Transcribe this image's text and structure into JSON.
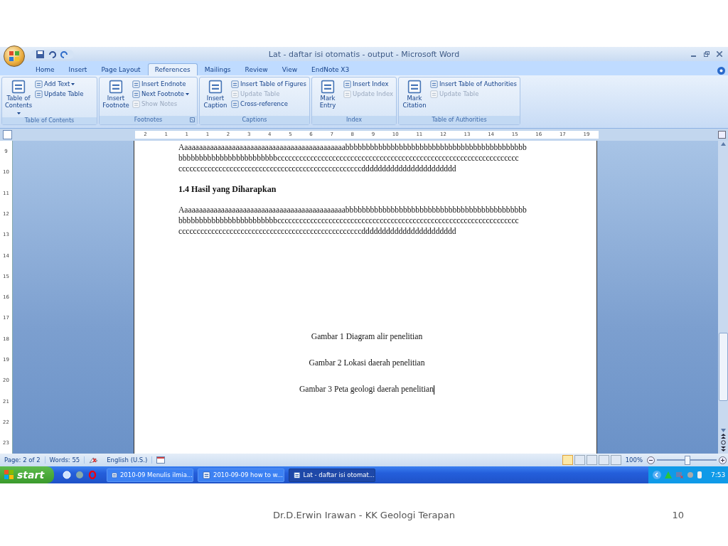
{
  "window": {
    "title": "Lat - daftar isi otomatis - output - Microsoft Word"
  },
  "tabs": [
    {
      "label": "Home",
      "selected": false
    },
    {
      "label": "Insert",
      "selected": false
    },
    {
      "label": "Page Layout",
      "selected": false
    },
    {
      "label": "References",
      "selected": true
    },
    {
      "label": "Mailings",
      "selected": false
    },
    {
      "label": "Review",
      "selected": false
    },
    {
      "label": "View",
      "selected": false
    },
    {
      "label": "EndNote X3",
      "selected": false
    }
  ],
  "ribbon_groups": [
    {
      "label": "Table of Contents",
      "large": [
        {
          "label": "Table of Contents",
          "dropdown": true
        }
      ],
      "small": [
        {
          "label": "Add Text",
          "disabled": false,
          "dropdown": true
        },
        {
          "label": "Update Table",
          "disabled": false,
          "dropdown": false
        }
      ],
      "launcher": false
    },
    {
      "label": "Footnotes",
      "large": [
        {
          "label": "Insert Footnote",
          "dropdown": false
        }
      ],
      "small": [
        {
          "label": "Insert Endnote",
          "disabled": false,
          "dropdown": false
        },
        {
          "label": "Next Footnote",
          "disabled": false,
          "dropdown": true
        },
        {
          "label": "Show Notes",
          "disabled": true,
          "dropdown": false
        }
      ],
      "launcher": true
    },
    {
      "label": "Captions",
      "large": [
        {
          "label": "Insert Caption",
          "dropdown": false
        }
      ],
      "small": [
        {
          "label": "Insert Table of Figures",
          "disabled": false,
          "dropdown": false
        },
        {
          "label": "Update Table",
          "disabled": true,
          "dropdown": false
        },
        {
          "label": "Cross-reference",
          "disabled": false,
          "dropdown": false
        }
      ],
      "launcher": false
    },
    {
      "label": "Index",
      "large": [
        {
          "label": "Mark Entry",
          "dropdown": false
        }
      ],
      "small": [
        {
          "label": "Insert Index",
          "disabled": false,
          "dropdown": false
        },
        {
          "label": "Update Index",
          "disabled": true,
          "dropdown": false
        }
      ],
      "launcher": false
    },
    {
      "label": "Table of Authorities",
      "large": [
        {
          "label": "Mark Citation",
          "dropdown": false
        }
      ],
      "small": [
        {
          "label": "Insert Table of Authorities",
          "disabled": false,
          "dropdown": false
        },
        {
          "label": "Update Table",
          "disabled": true,
          "dropdown": false
        }
      ],
      "launcher": false
    }
  ],
  "ruler": {
    "labels": [
      "2",
      "1",
      "1",
      "1",
      "2",
      "3",
      "4",
      "5",
      "6",
      "7",
      "8",
      "9",
      "10",
      "11",
      "12",
      "13",
      "14",
      "15",
      "16",
      "17",
      "19"
    ]
  },
  "vertical_ruler": {
    "labels": [
      "9",
      "10",
      "11",
      "12",
      "13",
      "14",
      "15",
      "16",
      "17",
      "18",
      "19",
      "20",
      "21",
      "22",
      "23"
    ]
  },
  "document": {
    "blocks": [
      {
        "kind": "paragraph",
        "lines": [
          "Aaaaaaaaaaaaaaaaaaaaaaaaaaaaaaaaaaaaaaaaaaaaabbbbbbbbbbbbbbbbbbbbbbbbbbbbbbbbbbbbbbbbbbbb",
          "bbbbbbbbbbbbbbbbbbbbbbbbcccccccccccccccccccccccccccccccccccccccccccccccccccccccccccccccccc",
          "ccccccccccccccccccccccccccccccccccccccccccccccccccddddddddddddddddddddddd"
        ]
      },
      {
        "kind": "heading",
        "text": "1.4 Hasil yang Diharapkan"
      },
      {
        "kind": "paragraph",
        "lines": [
          "Aaaaaaaaaaaaaaaaaaaaaaaaaaaaaaaaaaaaaaaaaaaaabbbbbbbbbbbbbbbbbbbbbbbbbbbbbbbbbbbbbbbbbbbb",
          "bbbbbbbbbbbbbbbbbbbbbbbbcccccccccccccccccccccccccccccccccccccccccccccccccccccccccccccccccc",
          "ccccccccccccccccccccccccccccccccccccccccccccccccccddddddddddddddddddddddd"
        ]
      },
      {
        "kind": "caption",
        "text": "Gambar 1 Diagram alir penelitian",
        "cursor": false
      },
      {
        "kind": "caption",
        "text": "Gambar 2 Lokasi daerah penelitian",
        "cursor": false
      },
      {
        "kind": "caption",
        "text": "Gambar 3 Peta geologi daerah penelitian",
        "cursor": true
      }
    ]
  },
  "status_bar": {
    "page": "Page: 2 of 2",
    "words": "Words: 55",
    "language": "English (U.S.)",
    "view_buttons": [
      {
        "selected": true
      },
      {
        "selected": false
      },
      {
        "selected": false
      },
      {
        "selected": false
      },
      {
        "selected": false
      }
    ],
    "zoom": "100%",
    "zoom_slider": {
      "level": 0.5
    }
  },
  "taskbar": {
    "start": "start",
    "tasks": [
      {
        "label": "2010-09 Menulis ilmia...",
        "selected": false
      },
      {
        "label": "2010-09-09 how to w...",
        "selected": false
      },
      {
        "label": "Lat - daftar isi otomat...",
        "selected": true
      }
    ],
    "time": "7:53"
  },
  "slide_footer": {
    "author": "Dr.D.Erwin Irawan - KK Geologi Terapan",
    "page_number": "10"
  }
}
